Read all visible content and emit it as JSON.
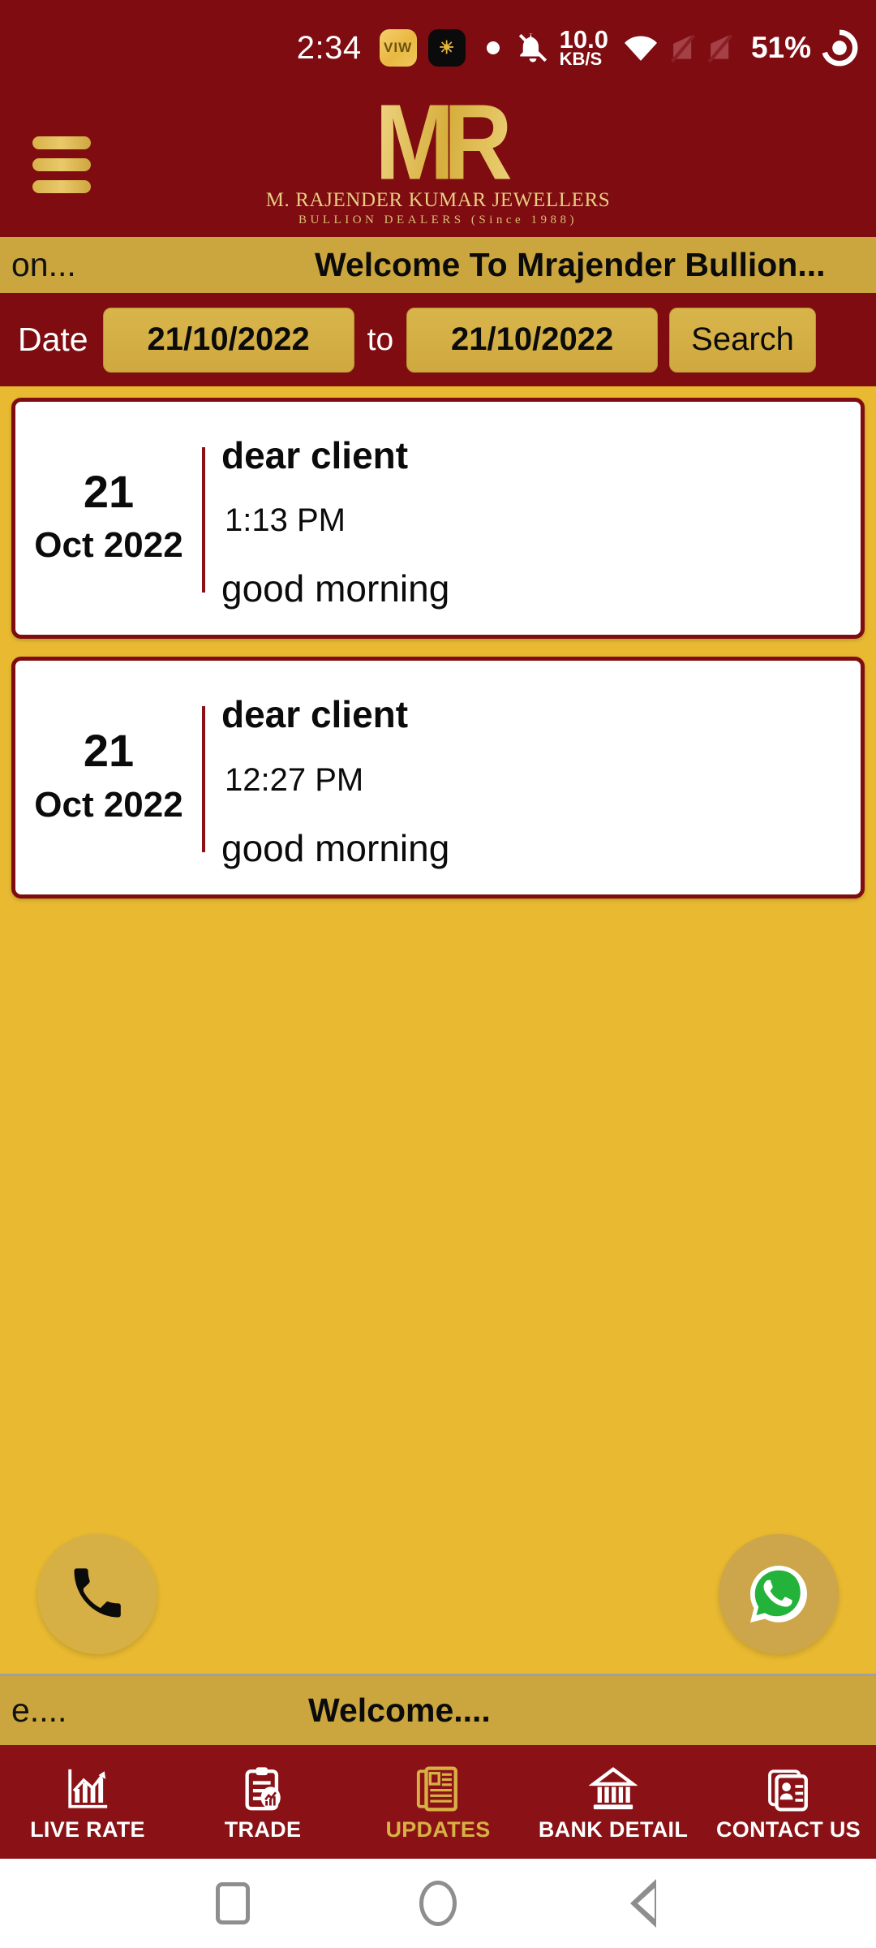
{
  "status_bar": {
    "time": "2:34",
    "app_icon_1_label": "VIW",
    "app_icon_2_label": "☀",
    "net_speed_value": "10.0",
    "net_speed_unit": "KB/S",
    "battery_percent": "51%"
  },
  "header": {
    "logo_mark": "MR",
    "logo_line1": "M. RAJENDER KUMAR JEWELLERS",
    "logo_line2": "BULLION DEALERS (Since 1988)"
  },
  "marquee_top": {
    "left_text": "on...",
    "center_text": "Welcome To Mrajender Bullion..."
  },
  "search": {
    "date_label": "Date",
    "from_date": "21/10/2022",
    "to_label": "to",
    "to_date": "21/10/2022",
    "search_label": "Search"
  },
  "messages": [
    {
      "day": "21",
      "month_year": "Oct 2022",
      "title": "dear client",
      "time": "1:13 PM",
      "text": "good morning"
    },
    {
      "day": "21",
      "month_year": "Oct 2022",
      "title": "dear client",
      "time": "12:27 PM",
      "text": "good morning"
    }
  ],
  "fab": {
    "call_icon": "phone-icon",
    "whatsapp_icon": "whatsapp-icon"
  },
  "marquee_bottom": {
    "left_text": "e....",
    "center_text": "Welcome...."
  },
  "bottom_nav": {
    "items": [
      {
        "label": "LIVE RATE",
        "icon": "chart-icon",
        "active": false
      },
      {
        "label": "TRADE",
        "icon": "clipboard-icon",
        "active": false
      },
      {
        "label": "UPDATES",
        "icon": "newspaper-icon",
        "active": true
      },
      {
        "label": "BANK DETAIL",
        "icon": "bank-icon",
        "active": false
      },
      {
        "label": "CONTACT US",
        "icon": "contact-card-icon",
        "active": false
      }
    ]
  },
  "colors": {
    "brand_maroon": "#7E0C10",
    "brand_gold": "#CBA63E",
    "background_gold": "#E8B931",
    "accent_gold": "#D8B145",
    "whatsapp_green": "#25B53C"
  }
}
